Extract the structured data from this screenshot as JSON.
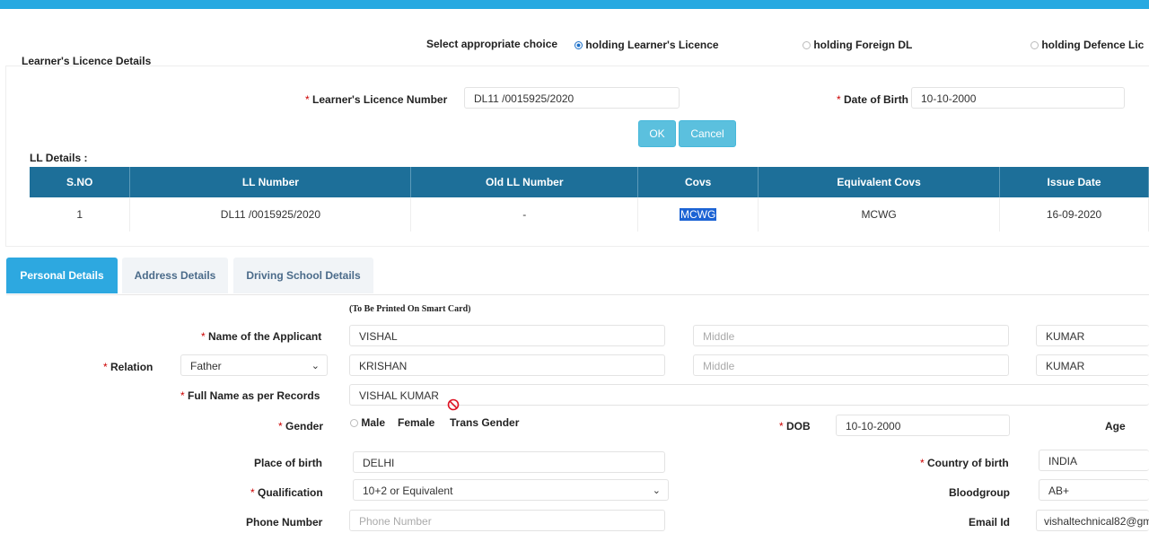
{
  "choice": {
    "label": "Select appropriate choice",
    "options": [
      "holding Learner's Licence",
      "holding Foreign DL",
      "holding Defence Lic"
    ],
    "selected_index": 0
  },
  "ll_section": {
    "title": "Learner's Licence Details",
    "number_label": "Learner's Licence Number",
    "number_value": "DL11 /0015925/2020",
    "dob_label": "Date of Birth",
    "dob_value": "10-10-2000",
    "ok_label": "OK",
    "cancel_label": "Cancel"
  },
  "ll_details": {
    "title": "LL Details :",
    "headers": [
      "S.NO",
      "LL Number",
      "Old LL Number",
      "Covs",
      "Equivalent Covs",
      "Issue Date"
    ],
    "rows": [
      [
        "1",
        "DL11 /0015925/2020",
        "-",
        "MCWG",
        "MCWG",
        "16-09-2020"
      ]
    ]
  },
  "tabs": [
    "Personal Details",
    "Address Details",
    "Driving School Details"
  ],
  "active_tab": 0,
  "personal": {
    "smart_card_note": "(To Be Printed On Smart Card)",
    "applicant_label": "Name of the Applicant",
    "applicant_first": "VISHAL",
    "applicant_middle_ph": "Middle",
    "applicant_last": "KUMAR",
    "relation_label": "Relation",
    "relation_value": "Father",
    "relation_first": "KRISHAN",
    "relation_middle_ph": "Middle",
    "relation_last": "KUMAR",
    "fullname_label": "Full Name as per Records",
    "fullname_value": "VISHAL KUMAR",
    "gender_label": "Gender",
    "gender_options": [
      "Male",
      "Female",
      "Trans Gender"
    ],
    "dob_label": "DOB",
    "dob_value": "10-10-2000",
    "age_label": "Age",
    "pob_label": "Place of birth",
    "pob_value": "DELHI",
    "cob_label": "Country of birth",
    "cob_value": "INDIA",
    "qual_label": "Qualification",
    "qual_value": "10+2 or Equivalent",
    "blood_label": "Bloodgroup",
    "blood_value": "AB+",
    "phone_label": "Phone Number",
    "phone_ph": "Phone Number",
    "email_label": "Email Id",
    "email_value": "vishaltechnical82@gm"
  },
  "colors": {
    "topbar": "#27a9e1",
    "table_header": "#1d6f99",
    "button": "#5bc0de",
    "active_tab": "#2da8e0"
  }
}
